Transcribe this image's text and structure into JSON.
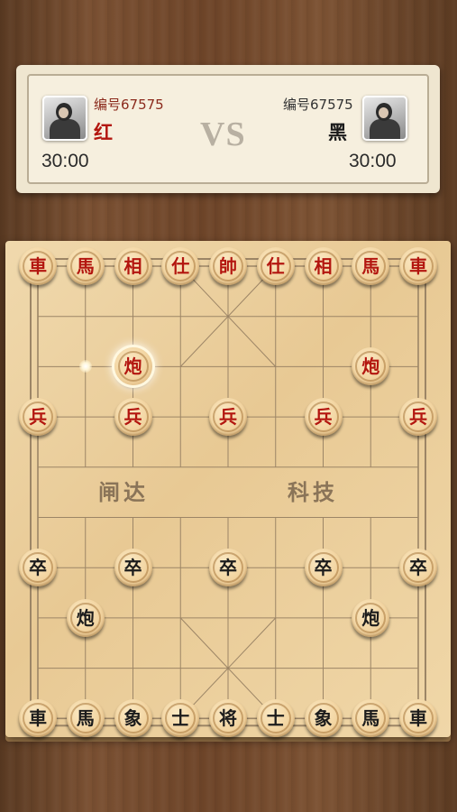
{
  "players": {
    "red": {
      "id_label": "编号67575",
      "name": "红",
      "time": "30:00"
    },
    "black": {
      "id_label": "编号67575",
      "name": "黑",
      "time": "30:00"
    },
    "vs_label": "VS"
  },
  "board": {
    "river_left": "闸达",
    "river_right": "科技",
    "pieces": [
      {
        "label": "車",
        "side": "red",
        "col": 0,
        "row": 0
      },
      {
        "label": "馬",
        "side": "red",
        "col": 1,
        "row": 0
      },
      {
        "label": "相",
        "side": "red",
        "col": 2,
        "row": 0
      },
      {
        "label": "仕",
        "side": "red",
        "col": 3,
        "row": 0
      },
      {
        "label": "帥",
        "side": "red",
        "col": 4,
        "row": 0
      },
      {
        "label": "仕",
        "side": "red",
        "col": 5,
        "row": 0
      },
      {
        "label": "相",
        "side": "red",
        "col": 6,
        "row": 0
      },
      {
        "label": "馬",
        "side": "red",
        "col": 7,
        "row": 0
      },
      {
        "label": "車",
        "side": "red",
        "col": 8,
        "row": 0
      },
      {
        "label": "炮",
        "side": "red",
        "col": 2,
        "row": 2,
        "selected": true
      },
      {
        "label": "炮",
        "side": "red",
        "col": 7,
        "row": 2
      },
      {
        "label": "兵",
        "side": "red",
        "col": 0,
        "row": 3
      },
      {
        "label": "兵",
        "side": "red",
        "col": 2,
        "row": 3
      },
      {
        "label": "兵",
        "side": "red",
        "col": 4,
        "row": 3
      },
      {
        "label": "兵",
        "side": "red",
        "col": 6,
        "row": 3
      },
      {
        "label": "兵",
        "side": "red",
        "col": 8,
        "row": 3
      },
      {
        "label": "卒",
        "side": "black",
        "col": 0,
        "row": 6
      },
      {
        "label": "卒",
        "side": "black",
        "col": 2,
        "row": 6
      },
      {
        "label": "卒",
        "side": "black",
        "col": 4,
        "row": 6
      },
      {
        "label": "卒",
        "side": "black",
        "col": 6,
        "row": 6
      },
      {
        "label": "卒",
        "side": "black",
        "col": 8,
        "row": 6
      },
      {
        "label": "炮",
        "side": "black",
        "col": 1,
        "row": 7
      },
      {
        "label": "炮",
        "side": "black",
        "col": 7,
        "row": 7
      },
      {
        "label": "車",
        "side": "black",
        "col": 0,
        "row": 9
      },
      {
        "label": "馬",
        "side": "black",
        "col": 1,
        "row": 9
      },
      {
        "label": "象",
        "side": "black",
        "col": 2,
        "row": 9
      },
      {
        "label": "士",
        "side": "black",
        "col": 3,
        "row": 9
      },
      {
        "label": "将",
        "side": "black",
        "col": 4,
        "row": 9
      },
      {
        "label": "士",
        "side": "black",
        "col": 5,
        "row": 9
      },
      {
        "label": "象",
        "side": "black",
        "col": 6,
        "row": 9
      },
      {
        "label": "馬",
        "side": "black",
        "col": 7,
        "row": 9
      },
      {
        "label": "車",
        "side": "black",
        "col": 8,
        "row": 9
      }
    ],
    "move_markers": [
      {
        "col": 1,
        "row": 2
      }
    ]
  }
}
